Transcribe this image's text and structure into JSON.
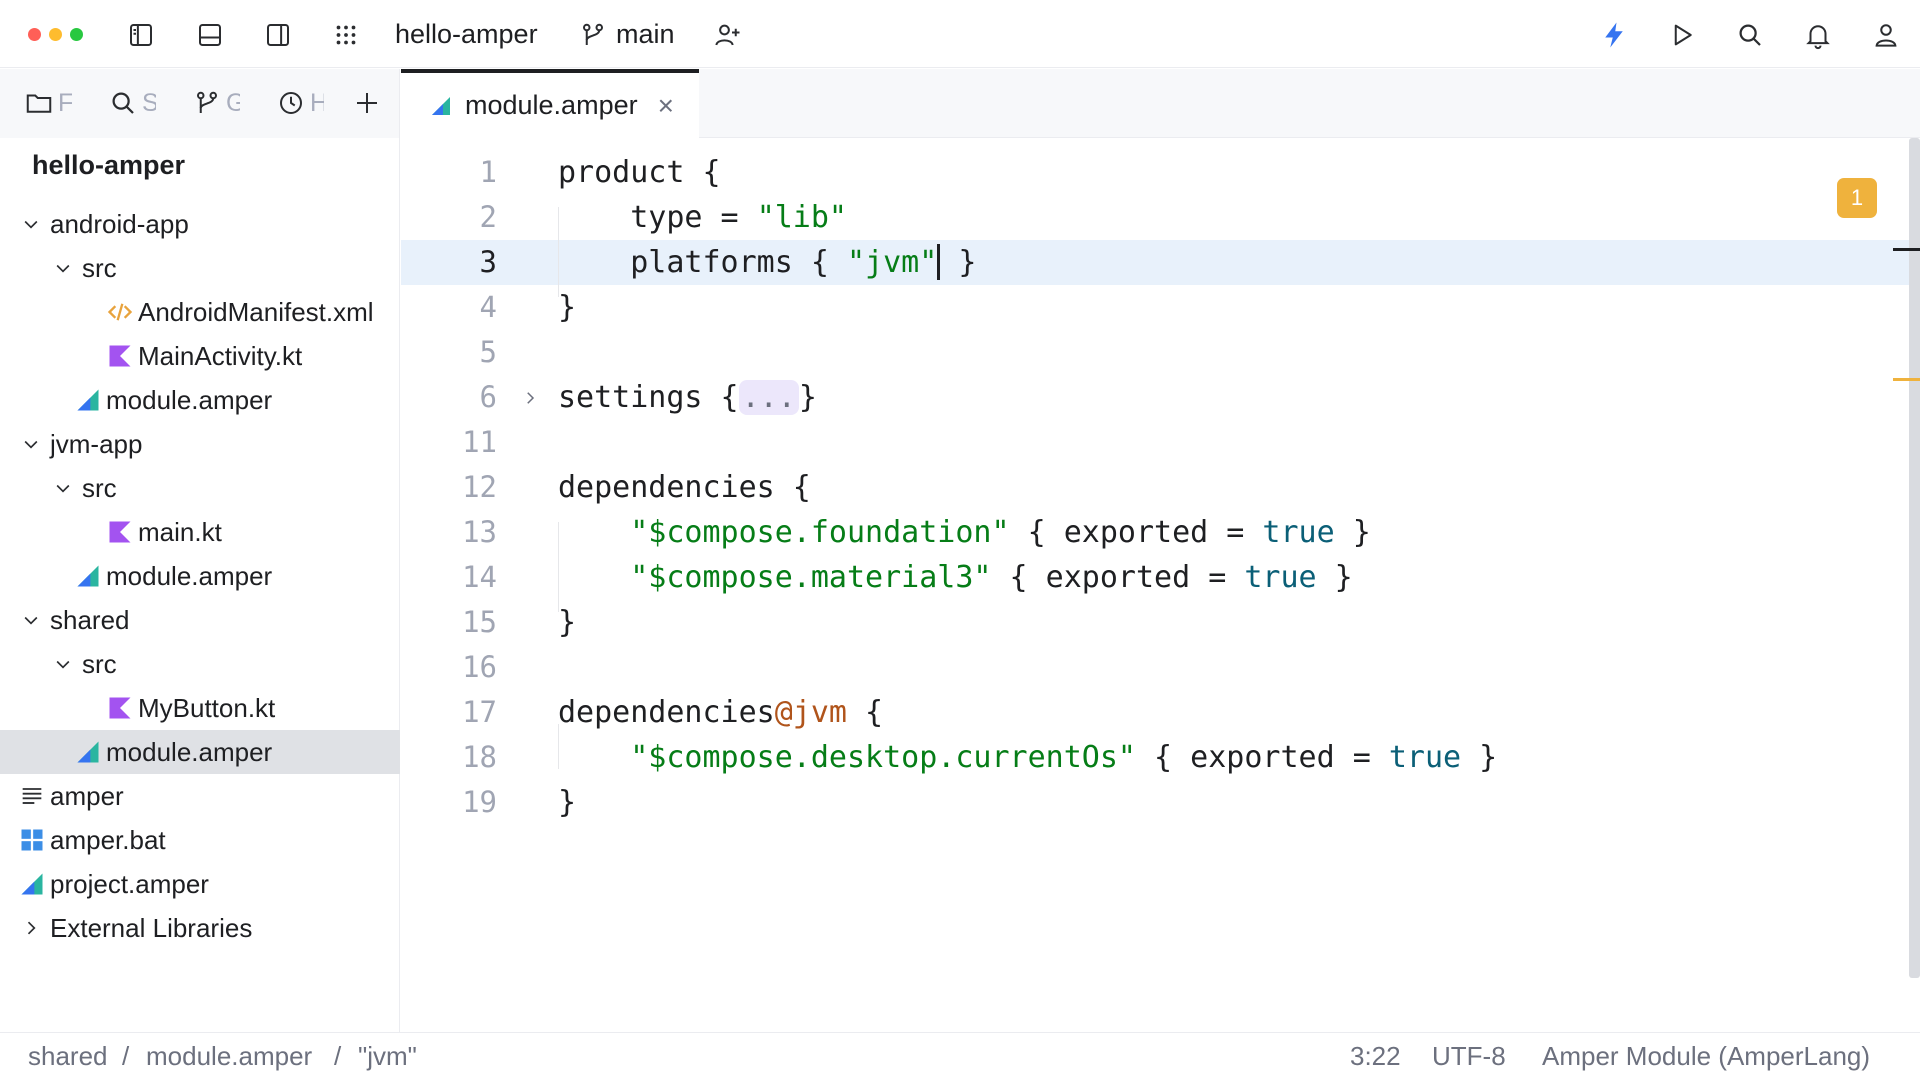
{
  "window": {
    "traffic_lights": [
      "#ff5f57",
      "#febc2e",
      "#28c840"
    ]
  },
  "titlebar": {
    "project_name": "hello-amper",
    "branch": "main",
    "icons": [
      "sidebar-left-icon",
      "bottom-panel-icon",
      "sidebar-right-icon",
      "apps-grid-icon",
      "add-collaborator-icon",
      "lightning-icon",
      "run-icon",
      "search-icon",
      "bell-icon",
      "account-icon"
    ]
  },
  "tool_tabs": [
    {
      "icon": "folder-icon",
      "label": "F"
    },
    {
      "icon": "search-icon",
      "label": "S"
    },
    {
      "icon": "branch-icon",
      "label": "G"
    },
    {
      "icon": "clock-icon",
      "label": "H"
    }
  ],
  "editor_tab": {
    "label": "module.amper",
    "close": "×"
  },
  "project": {
    "root": "hello-amper",
    "tree": [
      {
        "label": "android-app",
        "type": "folder-open",
        "depth": 0
      },
      {
        "label": "src",
        "type": "folder-open",
        "depth": 1
      },
      {
        "label": "AndroidManifest.xml",
        "type": "xml",
        "depth": 2
      },
      {
        "label": "MainActivity.kt",
        "type": "kotlin",
        "depth": 2
      },
      {
        "label": "module.amper",
        "type": "amper",
        "depth": 1
      },
      {
        "label": "jvm-app",
        "type": "folder-open",
        "depth": 0
      },
      {
        "label": "src",
        "type": "folder-open",
        "depth": 1
      },
      {
        "label": "main.kt",
        "type": "kotlin",
        "depth": 2
      },
      {
        "label": "module.amper",
        "type": "amper",
        "depth": 1
      },
      {
        "label": "shared",
        "type": "folder-open",
        "depth": 0
      },
      {
        "label": "src",
        "type": "folder-open",
        "depth": 1
      },
      {
        "label": "MyButton.kt",
        "type": "kotlin",
        "depth": 2
      },
      {
        "label": "module.amper",
        "type": "amper",
        "depth": 1,
        "selected": true
      },
      {
        "label": "amper",
        "type": "text-file",
        "depth": 0
      },
      {
        "label": "amper.bat",
        "type": "windows",
        "depth": 0
      },
      {
        "label": "project.amper",
        "type": "amper",
        "depth": 0
      },
      {
        "label": "External Libraries",
        "type": "folder-closed",
        "depth": 0
      }
    ]
  },
  "editor": {
    "current_line": "3",
    "warnings": "1",
    "lines": [
      {
        "n": "1",
        "tokens": [
          [
            "t",
            "product {"
          ]
        ]
      },
      {
        "n": "2",
        "tokens": [
          [
            "t",
            "    type = "
          ],
          [
            "s",
            "\"lib\""
          ]
        ]
      },
      {
        "n": "3",
        "tokens": [
          [
            "t",
            "    platforms { "
          ],
          [
            "s",
            "\"jvm\""
          ],
          [
            "caret",
            ""
          ],
          [
            "t",
            " }"
          ]
        ]
      },
      {
        "n": "4",
        "tokens": [
          [
            "t",
            "}"
          ]
        ]
      },
      {
        "n": "5",
        "tokens": []
      },
      {
        "n": "6",
        "tokens": [
          [
            "t",
            "settings {"
          ],
          [
            "fold",
            "..."
          ],
          [
            "t",
            "}"
          ]
        ],
        "folded": true
      },
      {
        "n": "11",
        "tokens": []
      },
      {
        "n": "12",
        "tokens": [
          [
            "t",
            "dependencies {"
          ]
        ]
      },
      {
        "n": "13",
        "tokens": [
          [
            "t",
            "    "
          ],
          [
            "s",
            "\"$compose.foundation\""
          ],
          [
            "t",
            " { exported = "
          ],
          [
            "k",
            "true"
          ],
          [
            "t",
            " }"
          ]
        ]
      },
      {
        "n": "14",
        "tokens": [
          [
            "t",
            "    "
          ],
          [
            "s",
            "\"$compose.material3\""
          ],
          [
            "t",
            " { exported = "
          ],
          [
            "k",
            "true"
          ],
          [
            "t",
            " }"
          ]
        ]
      },
      {
        "n": "15",
        "tokens": [
          [
            "t",
            "}"
          ]
        ]
      },
      {
        "n": "16",
        "tokens": []
      },
      {
        "n": "17",
        "tokens": [
          [
            "t",
            "dependencies"
          ],
          [
            "a",
            "@jvm"
          ],
          [
            "t",
            " {"
          ]
        ]
      },
      {
        "n": "18",
        "tokens": [
          [
            "t",
            "    "
          ],
          [
            "s",
            "\"$compose.desktop.currentOs\""
          ],
          [
            "t",
            " { exported = "
          ],
          [
            "k",
            "true"
          ],
          [
            "t",
            " }"
          ]
        ]
      },
      {
        "n": "19",
        "tokens": [
          [
            "t",
            "}"
          ]
        ]
      }
    ]
  },
  "statusbar": {
    "breadcrumbs": [
      "shared",
      "module.amper",
      "\"jvm\""
    ],
    "separator": "/",
    "position": "3:22",
    "encoding": "UTF-8",
    "file_type": "Amper Module (AmperLang)"
  }
}
